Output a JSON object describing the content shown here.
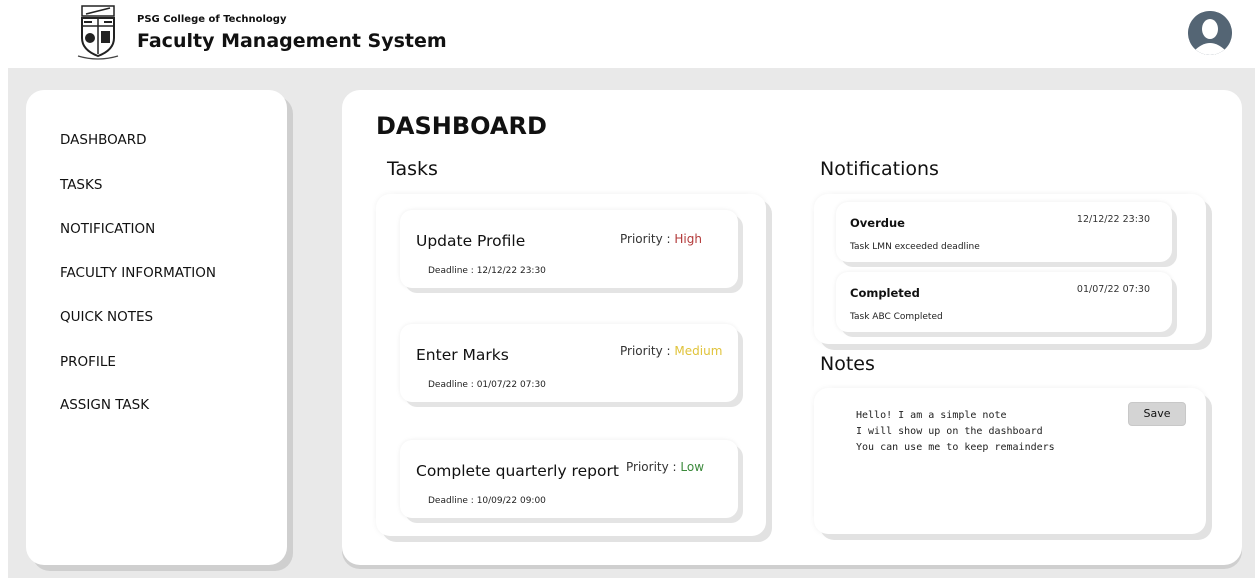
{
  "header": {
    "college": "PSG College of Technology",
    "system_name": "Faculty Management System"
  },
  "sidebar": {
    "items": [
      {
        "label": "DASHBOARD"
      },
      {
        "label": "TASKS"
      },
      {
        "label": "NOTIFICATION"
      },
      {
        "label": "FACULTY INFORMATION"
      },
      {
        "label": "QUICK NOTES"
      },
      {
        "label": "PROFILE"
      },
      {
        "label": "ASSIGN TASK"
      }
    ]
  },
  "main": {
    "title": "DASHBOARD",
    "tasks_heading": "Tasks",
    "notifications_heading": "Notifications",
    "notes_heading": "Notes"
  },
  "tasks": [
    {
      "name": "Update Profile",
      "priority_label": "Priority :",
      "priority": "High",
      "deadline": "Deadline : 12/12/22 23:30"
    },
    {
      "name": "Enter Marks",
      "priority_label": "Priority :",
      "priority": "Medium",
      "deadline": "Deadline : 01/07/22 07:30"
    },
    {
      "name": "Complete quarterly report",
      "priority_label": "Priority :",
      "priority": "Low",
      "deadline": "Deadline : 10/09/22 09:00"
    }
  ],
  "notifications": [
    {
      "title": "Overdue",
      "time": "12/12/22 23:30",
      "message": "Task LMN exceeded deadline"
    },
    {
      "title": "Completed",
      "time": "01/07/22 07:30",
      "message": "Task ABC Completed"
    }
  ],
  "notes": {
    "text": "Hello! I am a simple note\nI will show up on the dashboard\nYou can use me to keep remainders",
    "save_label": "Save"
  },
  "colors": {
    "priority_high": "#b33a3a",
    "priority_medium": "#e0c33a",
    "priority_low": "#3c8a3c",
    "background": "#e9e9e9",
    "avatar": "#546574"
  },
  "icons": {
    "logo": "college-crest-icon",
    "avatar": "user-avatar-icon"
  }
}
